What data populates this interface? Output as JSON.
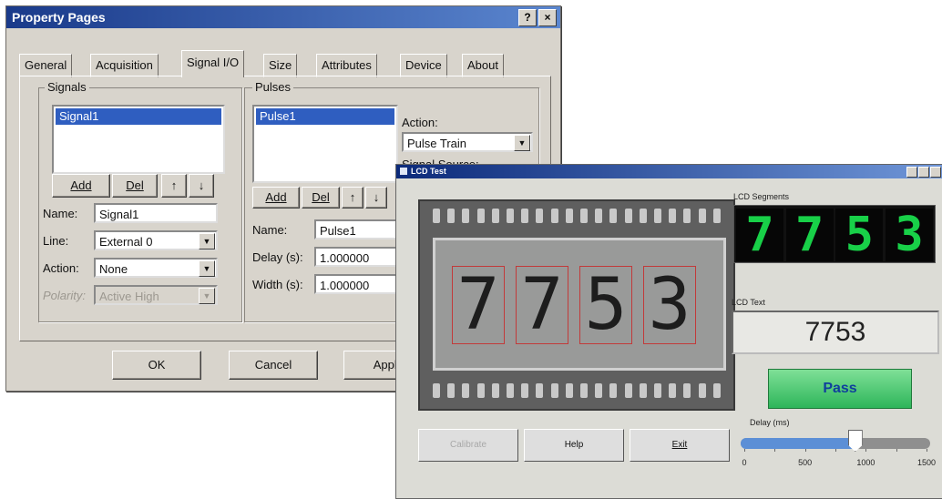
{
  "property_pages": {
    "title": "Property Pages",
    "help_btn": "?",
    "close_btn": "×",
    "tabs": [
      "General",
      "Acquisition",
      "Signal I/O",
      "Size",
      "Attributes",
      "Device",
      "About"
    ],
    "signals": {
      "group_label": "Signals",
      "selected": "Signal1",
      "add": "Add",
      "del": "Del",
      "up": "↑",
      "down": "↓",
      "name_label": "Name:",
      "name_value": "Signal1",
      "line_label": "Line:",
      "line_value": "External 0",
      "action_label": "Action:",
      "action_value": "None",
      "polarity_label": "Polarity:",
      "polarity_value": "Active High"
    },
    "pulses": {
      "group_label": "Pulses",
      "selected": "Pulse1",
      "action_label": "Action:",
      "action_value": "Pulse Train",
      "signal_source_label": "Signal Source:",
      "add": "Add",
      "del": "Del",
      "up": "↑",
      "down": "↓",
      "name_label": "Name:",
      "name_value": "Pulse1",
      "delay_label": "Delay (s):",
      "delay_value": "1.000000",
      "width_label": "Width (s):",
      "width_value": "1.000000"
    },
    "buttons": {
      "ok": "OK",
      "cancel": "Cancel",
      "apply": "Apply"
    }
  },
  "lcd_test": {
    "title": "LCD Test",
    "photo_digits": [
      "7",
      "7",
      "5",
      "3"
    ],
    "segments_label": "LCD Segments",
    "segment_digits": [
      "7",
      "7",
      "5",
      "3"
    ],
    "segment_color": "#18d048",
    "text_label": "LCD Text",
    "text_value": "7753",
    "pass_label": "Pass",
    "pass_color": "#2db55a",
    "delay_label": "Delay (ms)",
    "delay_value": 900,
    "delay_range": [
      0,
      1500
    ],
    "delay_ticks": [
      "0",
      "500",
      "1000",
      "1500"
    ],
    "buttons": {
      "calibrate": "Calibrate",
      "help": "Help",
      "exit": "Exit"
    }
  }
}
